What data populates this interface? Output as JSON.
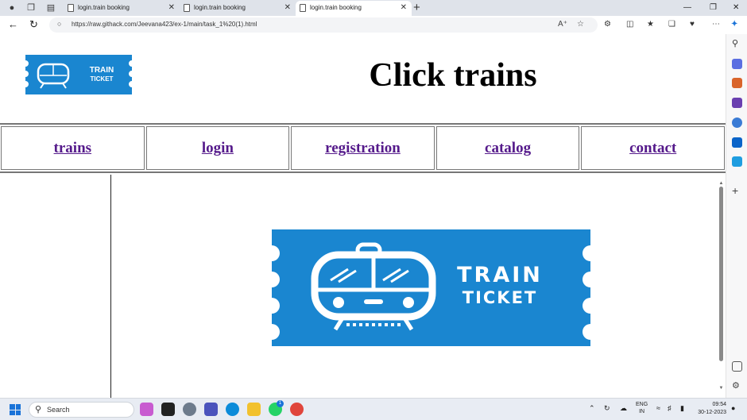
{
  "browser": {
    "tabs": [
      {
        "title": "login.train booking",
        "active": false
      },
      {
        "title": "login.train booking",
        "active": false
      },
      {
        "title": "login.train booking",
        "active": true
      }
    ],
    "url": "https://raw.githack.com/Jeevana423/ex-1/main/task_1%20(1).html"
  },
  "page": {
    "title": "Click trains",
    "logo_text": {
      "line1": "TRAIN",
      "line2": "TICKET"
    },
    "nav": [
      "trains",
      "login",
      "registration",
      "catalog",
      "contact"
    ],
    "colors": {
      "brand": "#1a86d0",
      "link": "#551a8b"
    }
  },
  "taskbar": {
    "search_placeholder": "Search",
    "lang": {
      "line1": "ENG",
      "line2": "IN"
    },
    "time": "09:54",
    "date": "30-12-2023",
    "whatsapp_badge": "1"
  }
}
